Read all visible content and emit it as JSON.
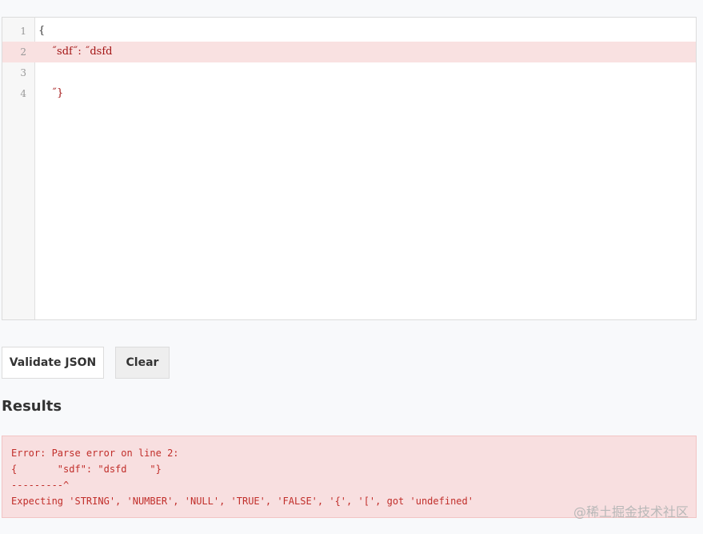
{
  "editor": {
    "lines": [
      {
        "number": "1",
        "text": "{"
      },
      {
        "number": "2",
        "text": "    ˝sdf˝: ˝dsfd"
      },
      {
        "number": "3",
        "text": ""
      },
      {
        "number": "4",
        "text": "    ˝}"
      }
    ]
  },
  "buttons": {
    "validate_label": "Validate JSON",
    "clear_label": "Clear"
  },
  "results": {
    "heading": "Results",
    "lines": [
      "Error: Parse error on line 2:",
      "{       \"sdf\": \"dsfd    \"}",
      "---------^",
      "Expecting 'STRING', 'NUMBER', 'NULL', 'TRUE', 'FALSE', '{', '[', got 'undefined'"
    ]
  },
  "watermark": "@稀土掘金技术社区",
  "colors": {
    "error_background": "#f8dfe0",
    "error_text": "#c12e2a",
    "error_line_highlight": "#f9e1e1"
  }
}
